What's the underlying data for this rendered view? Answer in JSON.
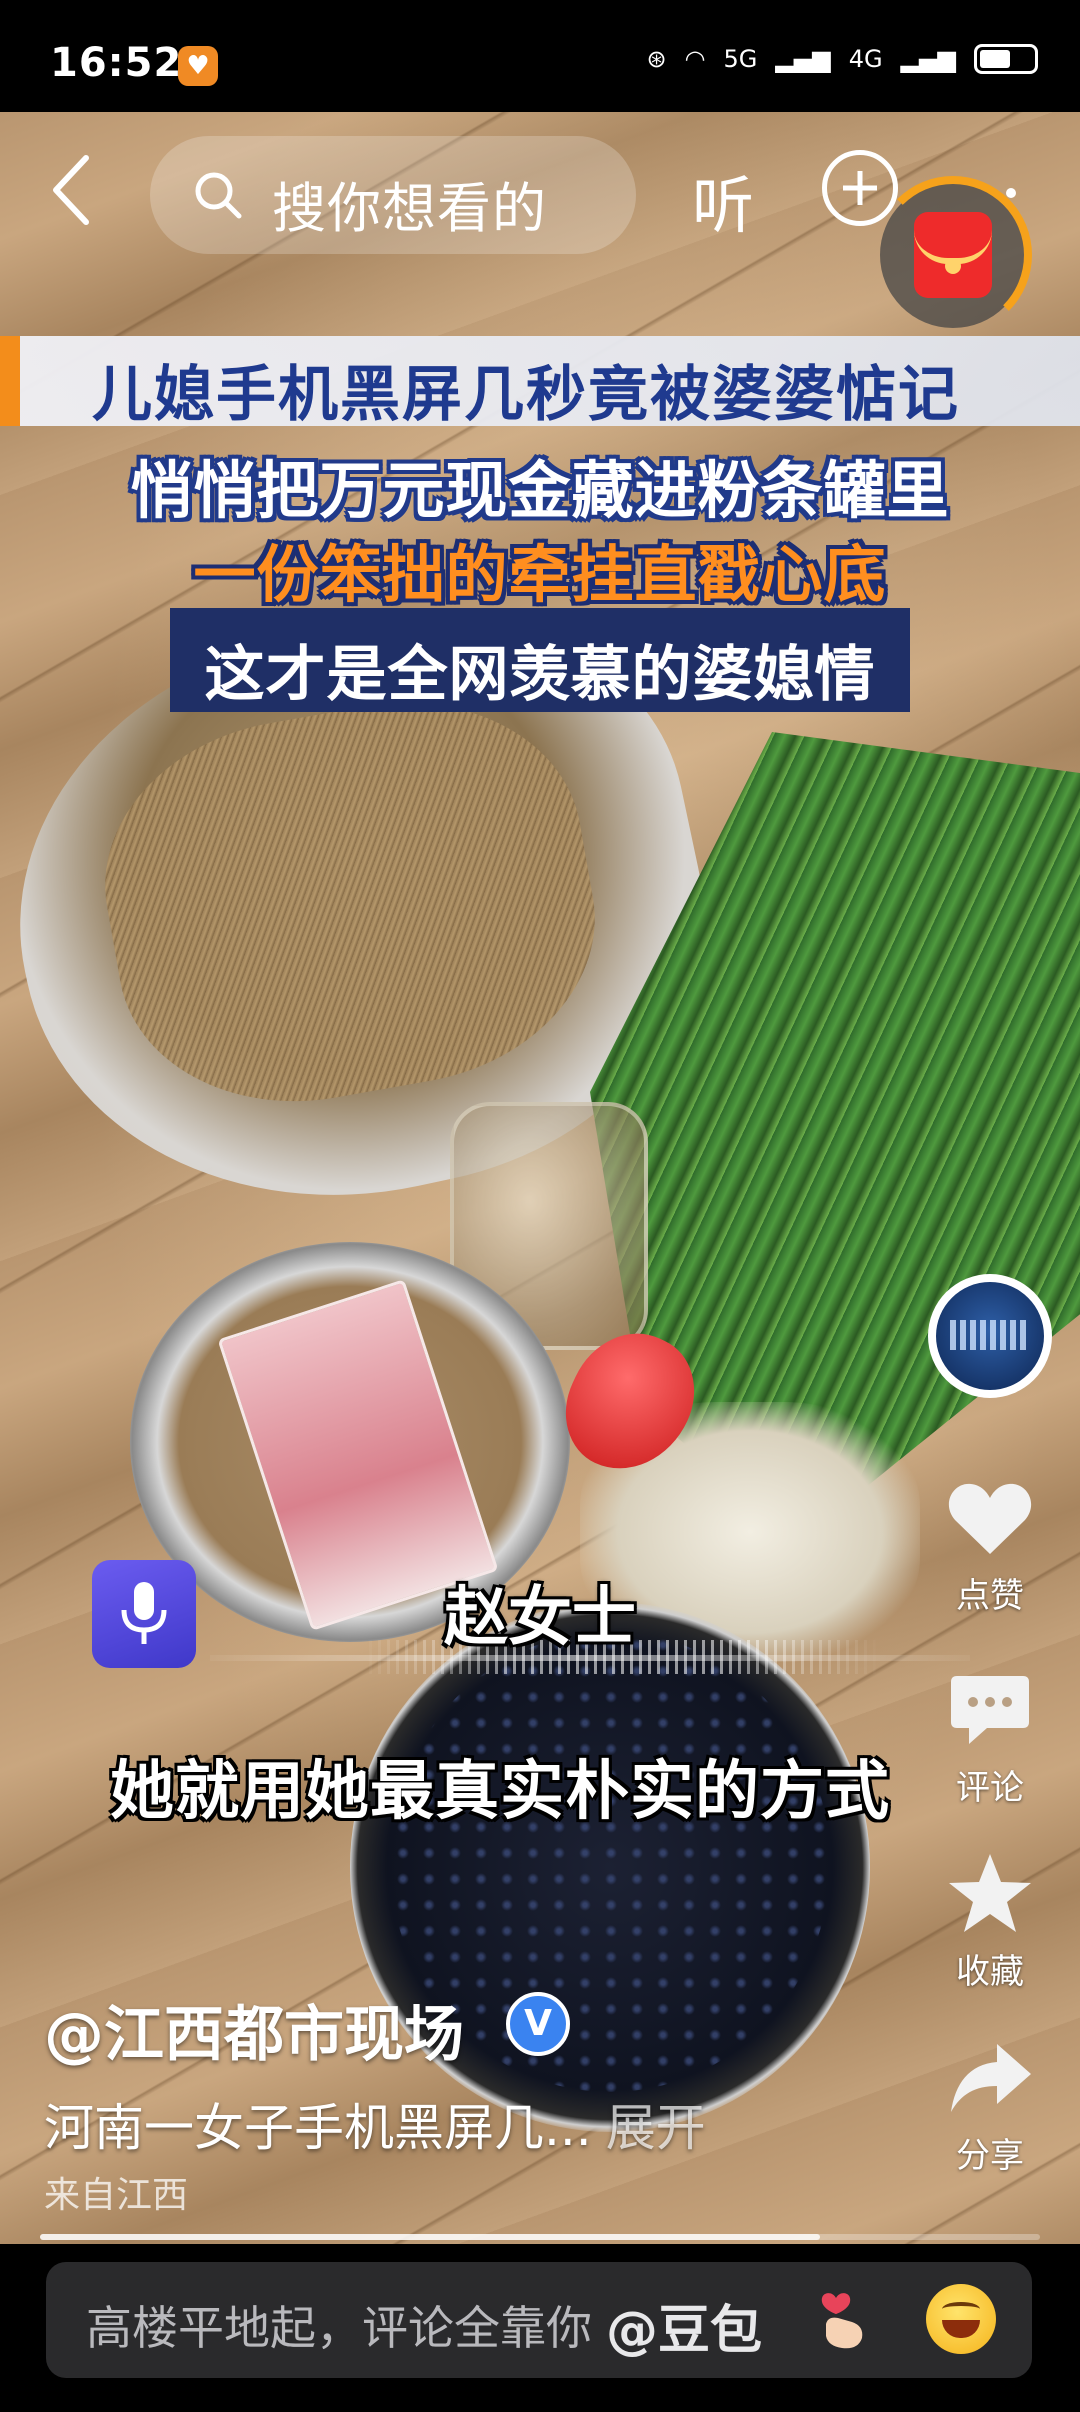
{
  "status_bar": {
    "time": "16:52",
    "network": "5G",
    "network2": "4G"
  },
  "top_bar": {
    "search_placeholder": "搜你想看的",
    "listen_label": "听"
  },
  "video": {
    "title_banner": "儿媳手机黑屏几秒竟被婆婆惦记",
    "caption_line1": "悄悄把万元现金藏进粉条罐里",
    "caption_line2": "一份笨拙的牵挂直戳心底",
    "caption_line3": "这才是全网羡慕的婆媳情",
    "speaker_name": "赵女士",
    "subtitle": "她就用她最真实朴实的方式",
    "progress": 0.78
  },
  "actions": {
    "like_label": "点赞",
    "comment_label": "评论",
    "favorite_label": "收藏",
    "share_label": "分享"
  },
  "post": {
    "author": "@江西都市现场",
    "verified_mark": "V",
    "description": "河南一女子手机黑屏几...",
    "expand_label": "展开",
    "location": "来自江西"
  },
  "comment_bar": {
    "placeholder": "高楼平地起，评论全靠你",
    "mention": "@豆包"
  },
  "colors": {
    "accent_orange": "#f38d1b",
    "title_blue": "#1f3a8f",
    "caption_orange": "#ff8e1f",
    "verified_blue": "#3a83f0"
  }
}
